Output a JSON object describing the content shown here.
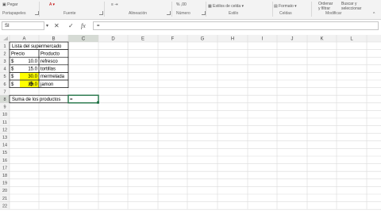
{
  "ribbon": {
    "clipboard": {
      "paste": "Pegar",
      "group": "Portapapeles"
    },
    "font": {
      "group": "Fuente"
    },
    "alignment": {
      "group": "Alineación"
    },
    "number": {
      "group": "Número"
    },
    "styles": {
      "cell_styles": "Estilos de celda",
      "group": "Estilo"
    },
    "cells": {
      "format": "Formato",
      "group": "Celdas"
    },
    "editing": {
      "sort_line1": "Ordenar",
      "sort_line2": "y filtrar",
      "find_line1": "Buscar y",
      "find_line2": "seleccionar",
      "group": "Modificar"
    }
  },
  "formula_bar": {
    "name_box": "SI",
    "cancel": "✕",
    "enter": "✓",
    "fx": "fx",
    "formula": "="
  },
  "sheet": {
    "columns": [
      "A",
      "B",
      "C",
      "D",
      "E",
      "F",
      "G",
      "H",
      "I",
      "J",
      "K",
      "L"
    ],
    "rows": [
      "1",
      "2",
      "3",
      "4",
      "5",
      "6",
      "7",
      "8",
      "9",
      "10",
      "11",
      "12",
      "13",
      "14",
      "15",
      "16",
      "17",
      "18",
      "19",
      "20",
      "21",
      "22"
    ],
    "title": "Lista del supermercado",
    "header_price": "Precio",
    "header_product": "Producto",
    "items": [
      {
        "currency": "$",
        "price": "10.0",
        "product": "refresco"
      },
      {
        "currency": "$",
        "price": "15.0",
        "product": "tortillas"
      },
      {
        "currency": "$",
        "price": "30.0",
        "product": "mermelada"
      },
      {
        "currency": "$",
        "price": "25.0",
        "product": "jamon"
      }
    ],
    "sum_label": "Suma de los productos",
    "sum_value": "=",
    "highlight_color": "#ffff00",
    "active_cell_color": "#217346"
  }
}
